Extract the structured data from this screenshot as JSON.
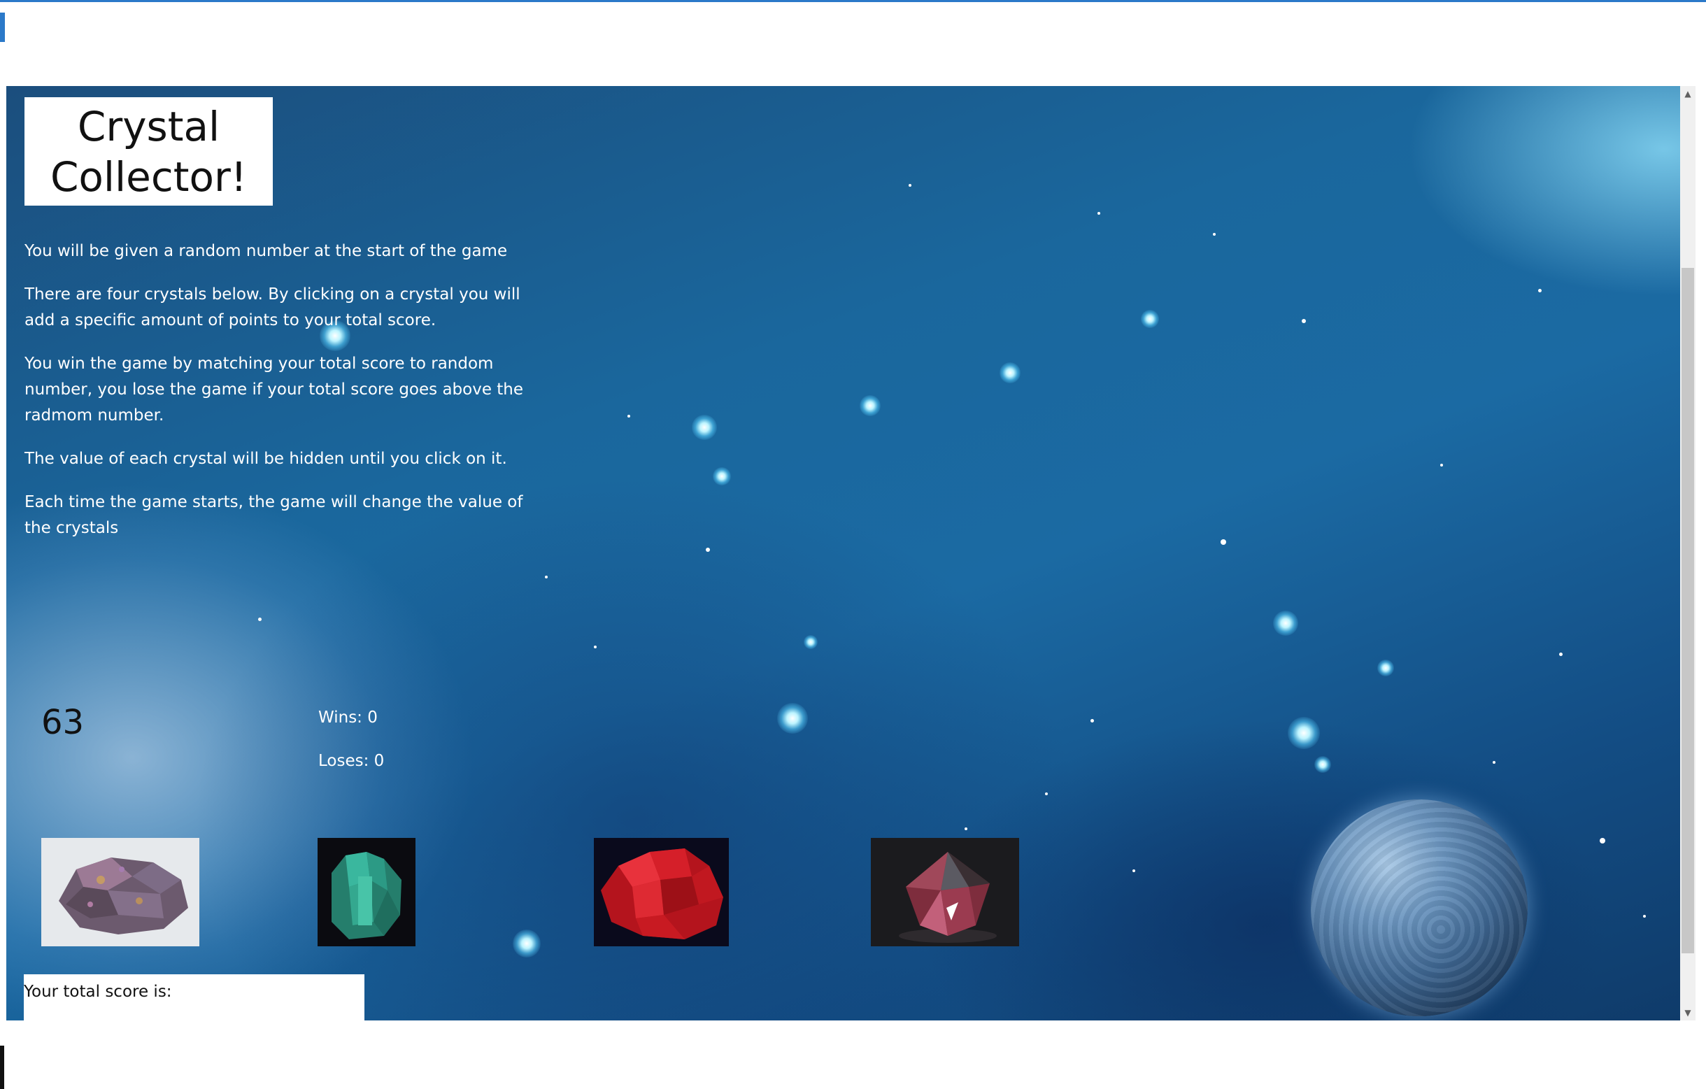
{
  "game": {
    "title": "Crystal Collector!",
    "instructions": [
      "You will be given a random number at the start of the game",
      "There are four crystals below. By clicking on a crystal you will add a specific amount of points to your total score.",
      "You win the game by matching your total score to random number, you lose the game if your total score goes above the radmom number.",
      "The value of each crystal will be hidden until you click on it.",
      "Each time the game starts, the game will change the value of the crystals"
    ],
    "target_number": "63",
    "wins_text": "Wins: 0",
    "loses_text": "Loses: 0",
    "total_score_label": "Your total score is:"
  },
  "crystals": [
    {
      "name": "bornite-crystal",
      "color": "#8a6f86"
    },
    {
      "name": "amazonite-crystal",
      "color": "#2fa58f"
    },
    {
      "name": "red-crystal",
      "color": "#d41b24"
    },
    {
      "name": "garnet-crystal",
      "color": "#8e3a4a"
    }
  ],
  "colors": {
    "window_accent": "#2b79c9",
    "space_blue": "#1b6aa3",
    "text_light": "#ffffff"
  },
  "icons": {
    "scroll_up": "▲",
    "scroll_down": "▼"
  }
}
